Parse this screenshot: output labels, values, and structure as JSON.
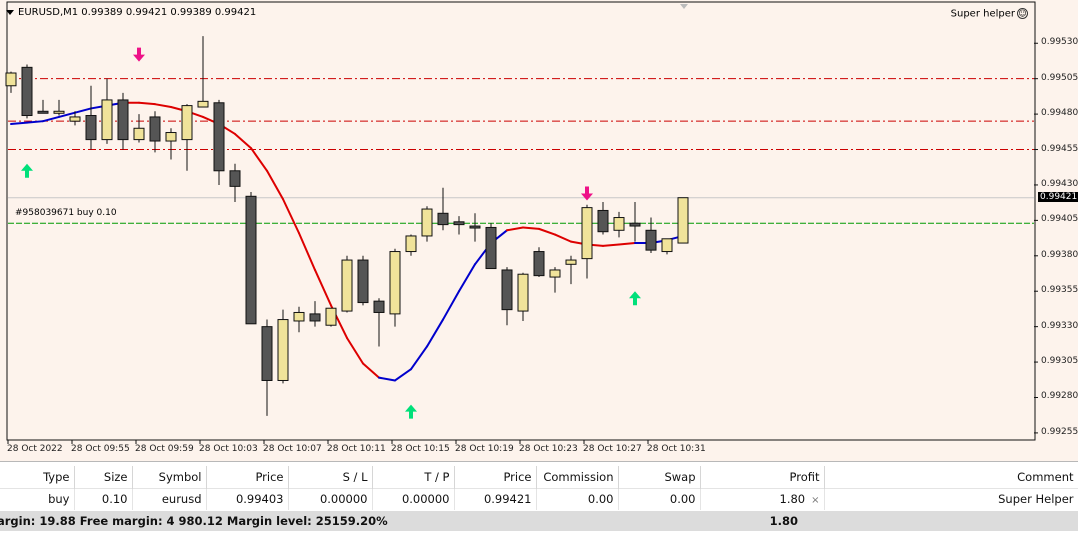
{
  "chart": {
    "symbol_line": "EURUSD,M1  0.99389 0.99421 0.99389 0.99421",
    "indicator_name": "Super helper",
    "order_label": "#958039671 buy 0.10",
    "current_price_label": "0.99421",
    "price_labels": [
      "0.99530",
      "0.99505",
      "0.99480",
      "0.99455",
      "0.99430",
      "0.99405",
      "0.99380",
      "0.99355",
      "0.99330",
      "0.99305",
      "0.99280",
      "0.99255"
    ],
    "time_labels": [
      "28 Oct 2022",
      "28 Oct 09:55",
      "28 Oct 09:59",
      "28 Oct 10:03",
      "28 Oct 10:07",
      "28 Oct 10:11",
      "28 Oct 10:15",
      "28 Oct 10:19",
      "28 Oct 10:23",
      "28 Oct 10:27",
      "28 Oct 10:31"
    ],
    "colors": {
      "background": "#fdf3ec",
      "bull_candle": "#f0e39a",
      "bear_candle": "#555555",
      "ma_up": "#0000cc",
      "ma_down": "#dd0000",
      "level_line": "#cc0000",
      "order_line": "#009900",
      "arrow_up": "#00e07a",
      "arrow_down": "#ee1188"
    },
    "candles": [
      {
        "o": 0.995,
        "h": 0.9951,
        "l": 0.99495,
        "c": 0.99509
      },
      {
        "o": 0.99513,
        "h": 0.99515,
        "l": 0.99477,
        "c": 0.99479
      },
      {
        "o": 0.99482,
        "h": 0.9949,
        "l": 0.99481,
        "c": 0.99481
      },
      {
        "o": 0.99482,
        "h": 0.9949,
        "l": 0.99479,
        "c": 0.99482
      },
      {
        "o": 0.99475,
        "h": 0.99482,
        "l": 0.99472,
        "c": 0.99478
      },
      {
        "o": 0.99479,
        "h": 0.995,
        "l": 0.99455,
        "c": 0.99462
      },
      {
        "o": 0.99462,
        "h": 0.99505,
        "l": 0.99459,
        "c": 0.9949
      },
      {
        "o": 0.9949,
        "h": 0.99495,
        "l": 0.99455,
        "c": 0.99462
      },
      {
        "o": 0.99462,
        "h": 0.9948,
        "l": 0.9946,
        "c": 0.9947
      },
      {
        "o": 0.99478,
        "h": 0.99482,
        "l": 0.99453,
        "c": 0.99461
      },
      {
        "o": 0.99461,
        "h": 0.9947,
        "l": 0.99448,
        "c": 0.99467
      },
      {
        "o": 0.99462,
        "h": 0.99487,
        "l": 0.9944,
        "c": 0.99486
      },
      {
        "o": 0.99485,
        "h": 0.99535,
        "l": 0.99485,
        "c": 0.99489
      },
      {
        "o": 0.99488,
        "h": 0.9949,
        "l": 0.9943,
        "c": 0.9944
      },
      {
        "o": 0.9944,
        "h": 0.99445,
        "l": 0.99418,
        "c": 0.99429
      },
      {
        "o": 0.99422,
        "h": 0.99425,
        "l": 0.99333,
        "c": 0.99332
      },
      {
        "o": 0.9933,
        "h": 0.99335,
        "l": 0.99267,
        "c": 0.99292
      },
      {
        "o": 0.99292,
        "h": 0.99342,
        "l": 0.9929,
        "c": 0.99335
      },
      {
        "o": 0.99334,
        "h": 0.99344,
        "l": 0.99326,
        "c": 0.9934
      },
      {
        "o": 0.99339,
        "h": 0.99348,
        "l": 0.9933,
        "c": 0.99334
      },
      {
        "o": 0.99331,
        "h": 0.99343,
        "l": 0.9933,
        "c": 0.99343
      },
      {
        "o": 0.99341,
        "h": 0.9938,
        "l": 0.9934,
        "c": 0.99377
      },
      {
        "o": 0.99377,
        "h": 0.9938,
        "l": 0.99345,
        "c": 0.99347
      },
      {
        "o": 0.99348,
        "h": 0.9935,
        "l": 0.99316,
        "c": 0.9934
      },
      {
        "o": 0.99339,
        "h": 0.99385,
        "l": 0.9933,
        "c": 0.99383
      },
      {
        "o": 0.99383,
        "h": 0.99395,
        "l": 0.9938,
        "c": 0.99394
      },
      {
        "o": 0.99394,
        "h": 0.99415,
        "l": 0.9939,
        "c": 0.99413
      },
      {
        "o": 0.9941,
        "h": 0.99428,
        "l": 0.99398,
        "c": 0.99402
      },
      {
        "o": 0.99404,
        "h": 0.99408,
        "l": 0.99395,
        "c": 0.99402
      },
      {
        "o": 0.99401,
        "h": 0.9941,
        "l": 0.9939,
        "c": 0.994
      },
      {
        "o": 0.994,
        "h": 0.99403,
        "l": 0.99372,
        "c": 0.99371
      },
      {
        "o": 0.9937,
        "h": 0.99372,
        "l": 0.99331,
        "c": 0.99342
      },
      {
        "o": 0.99341,
        "h": 0.99368,
        "l": 0.99334,
        "c": 0.99367
      },
      {
        "o": 0.99383,
        "h": 0.99386,
        "l": 0.99365,
        "c": 0.99366
      },
      {
        "o": 0.99365,
        "h": 0.99372,
        "l": 0.99354,
        "c": 0.9937
      },
      {
        "o": 0.99374,
        "h": 0.9938,
        "l": 0.9936,
        "c": 0.99377
      },
      {
        "o": 0.99378,
        "h": 0.99416,
        "l": 0.99364,
        "c": 0.99414
      },
      {
        "o": 0.99412,
        "h": 0.99418,
        "l": 0.99395,
        "c": 0.99397
      },
      {
        "o": 0.99398,
        "h": 0.99411,
        "l": 0.99393,
        "c": 0.99407
      },
      {
        "o": 0.99403,
        "h": 0.99418,
        "l": 0.9939,
        "c": 0.99401
      },
      {
        "o": 0.99398,
        "h": 0.99407,
        "l": 0.99382,
        "c": 0.99384
      },
      {
        "o": 0.99383,
        "h": 0.99392,
        "l": 0.99381,
        "c": 0.99392
      },
      {
        "o": 0.99389,
        "h": 0.99421,
        "l": 0.99389,
        "c": 0.99421
      }
    ],
    "moving_average": [
      {
        "v": 0.99473,
        "dir": "up"
      },
      {
        "v": 0.99474,
        "dir": "up"
      },
      {
        "v": 0.99475,
        "dir": "up"
      },
      {
        "v": 0.99478,
        "dir": "up"
      },
      {
        "v": 0.99481,
        "dir": "up"
      },
      {
        "v": 0.99484,
        "dir": "up"
      },
      {
        "v": 0.99486,
        "dir": "up"
      },
      {
        "v": 0.99488,
        "dir": "up"
      },
      {
        "v": 0.99488,
        "dir": "down"
      },
      {
        "v": 0.99487,
        "dir": "down"
      },
      {
        "v": 0.99485,
        "dir": "down"
      },
      {
        "v": 0.99482,
        "dir": "down"
      },
      {
        "v": 0.99478,
        "dir": "down"
      },
      {
        "v": 0.99473,
        "dir": "down"
      },
      {
        "v": 0.99466,
        "dir": "down"
      },
      {
        "v": 0.99456,
        "dir": "down"
      },
      {
        "v": 0.9944,
        "dir": "down"
      },
      {
        "v": 0.9942,
        "dir": "down"
      },
      {
        "v": 0.99396,
        "dir": "down"
      },
      {
        "v": 0.9937,
        "dir": "down"
      },
      {
        "v": 0.99345,
        "dir": "down"
      },
      {
        "v": 0.99322,
        "dir": "down"
      },
      {
        "v": 0.99304,
        "dir": "down"
      },
      {
        "v": 0.99294,
        "dir": "down"
      },
      {
        "v": 0.99292,
        "dir": "up"
      },
      {
        "v": 0.993,
        "dir": "up"
      },
      {
        "v": 0.99316,
        "dir": "up"
      },
      {
        "v": 0.99335,
        "dir": "up"
      },
      {
        "v": 0.99355,
        "dir": "up"
      },
      {
        "v": 0.99374,
        "dir": "up"
      },
      {
        "v": 0.99389,
        "dir": "up"
      },
      {
        "v": 0.99398,
        "dir": "up"
      },
      {
        "v": 0.994,
        "dir": "down"
      },
      {
        "v": 0.99399,
        "dir": "down"
      },
      {
        "v": 0.99395,
        "dir": "down"
      },
      {
        "v": 0.9939,
        "dir": "down"
      },
      {
        "v": 0.99388,
        "dir": "down"
      },
      {
        "v": 0.99387,
        "dir": "down"
      },
      {
        "v": 0.99388,
        "dir": "down"
      },
      {
        "v": 0.99389,
        "dir": "down"
      },
      {
        "v": 0.99389,
        "dir": "up"
      },
      {
        "v": 0.99391,
        "dir": "up"
      },
      {
        "v": 0.99394,
        "dir": "up"
      }
    ],
    "level_lines": [
      0.99505,
      0.99475,
      0.99455
    ],
    "order_price": 0.99403,
    "current_price": 0.99421,
    "signals": [
      {
        "type": "up",
        "bar": 1,
        "price": 0.9944
      },
      {
        "type": "down",
        "bar": 8,
        "price": 0.99522
      },
      {
        "type": "down",
        "bar": 36,
        "price": 0.99424
      },
      {
        "type": "up",
        "bar": 25,
        "price": 0.9927
      },
      {
        "type": "up",
        "bar": 39,
        "price": 0.9935
      }
    ],
    "y_range": [
      0.9925,
      0.99545
    ]
  },
  "table": {
    "headers": [
      "Type",
      "Size",
      "Symbol",
      "Price",
      "S / L",
      "T / P",
      "Price",
      "Commission",
      "Swap",
      "Profit",
      "Comment"
    ],
    "row": [
      "buy",
      "0.10",
      "eurusd",
      "0.99403",
      "0.00000",
      "0.00000",
      "0.99421",
      "0.00",
      "0.00",
      "1.80",
      "Super Helper"
    ],
    "close_symbol": "×"
  },
  "summary": {
    "text": "argin: 19.88  Free margin: 4 980.12  Margin level: 25159.20%",
    "profit": "1.80"
  }
}
